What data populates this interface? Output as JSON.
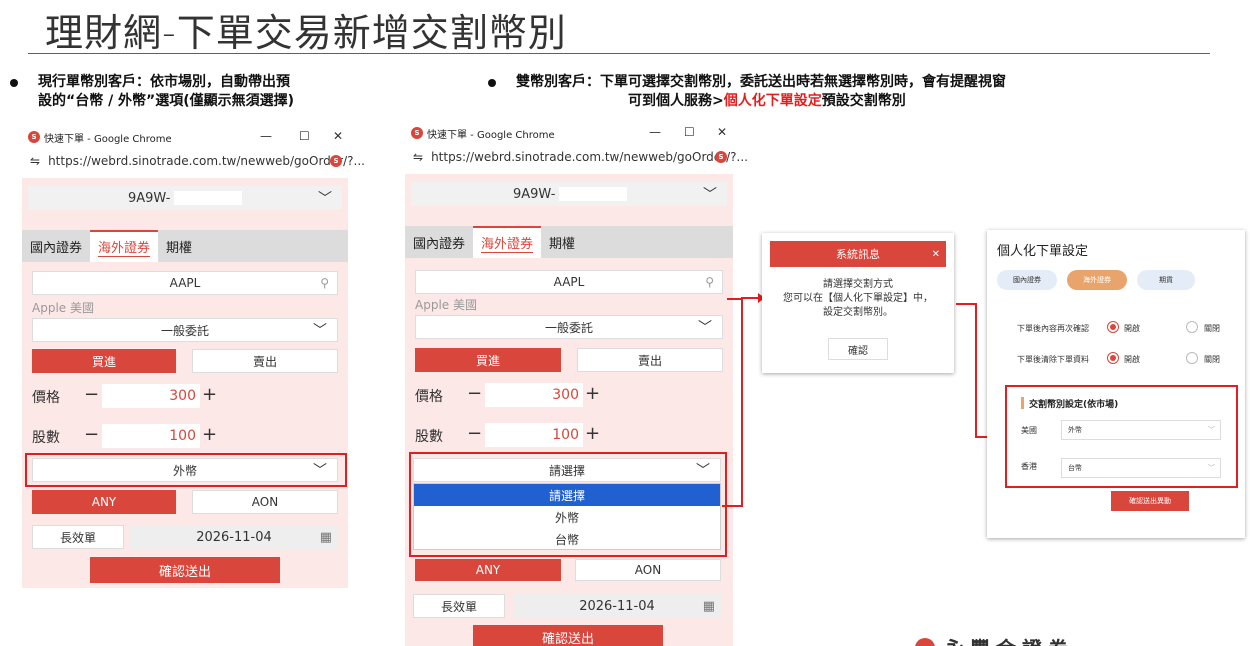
{
  "title": "理財網-下單交易新增交割幣別",
  "bullets": {
    "left_line1": "現行單幣別客戶：依市場別，自動帶出預",
    "left_line2": "設的“台幣 / 外幣”選項(僅顯示無須選擇)",
    "right_line1": "雙幣別客戶：下單可選擇交割幣別，委託送出時若無選擇幣別時，會有提醒視窗",
    "right_line2_a": "可到個人服務>",
    "right_line2_red": "個人化下單設定",
    "right_line2_b": "預設交割幣別"
  },
  "window_left": {
    "tab_title": "快速下單 - Google Chrome",
    "url": "https://webrd.sinotrade.com.tw/newweb/goOrder/?...",
    "account": "9A9W-",
    "tabs": [
      "國內證券",
      "海外證券",
      "期權"
    ],
    "symbol": "AAPL",
    "symbol_desc": "Apple 美國",
    "order_type": "一般委託",
    "buy": "買進",
    "sell": "賣出",
    "price_label": "價格",
    "price": "300",
    "qty_label": "股數",
    "qty": "100",
    "currency": "外幣",
    "any": "ANY",
    "aon": "AON",
    "validity": "長效單",
    "date": "2026-11-04",
    "submit": "確認送出"
  },
  "window_right": {
    "tab_title": "快速下單 - Google Chrome",
    "url": "https://webrd.sinotrade.com.tw/newweb/goOrder/?...",
    "account": "9A9W-",
    "tabs": [
      "國內證券",
      "海外證券",
      "期權"
    ],
    "symbol": "AAPL",
    "symbol_desc": "Apple 美國",
    "order_type": "一般委託",
    "buy": "買進",
    "sell": "賣出",
    "price_label": "價格",
    "price": "300",
    "qty_label": "股數",
    "qty": "100",
    "currency": "請選擇",
    "options": [
      "請選擇",
      "外幣",
      "台幣"
    ],
    "any": "ANY",
    "aon": "AON",
    "validity": "長效單",
    "date": "2026-11-04",
    "submit": "確認送出"
  },
  "alert": {
    "header": "系統訊息",
    "line1": "請選擇交割方式",
    "line2": "您可以在【個人化下單設定】中，",
    "line3": "設定交割幣別。",
    "ok": "確認"
  },
  "settings": {
    "title": "個人化下單設定",
    "tabs": [
      "國內證券",
      "海外證券",
      "期貨"
    ],
    "row1_label": "下單後內容再次確認",
    "row2_label": "下單後清除下單資料",
    "on": "開啟",
    "off": "關閉",
    "section_title": "交割幣別設定(依市場)",
    "us_label": "美國",
    "us_value": "外幣",
    "hk_label": "香港",
    "hk_value": "台幣",
    "save": "確認送出異動"
  },
  "footer_fragment": "永豐金證券",
  "colors": {
    "brand_red": "#d9463b",
    "highlight_red": "#e02020",
    "select_blue": "#2060d0"
  }
}
